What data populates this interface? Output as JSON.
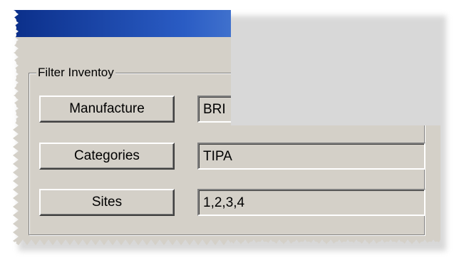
{
  "window": {
    "titlebar_colors": [
      "#0b2f8a",
      "#2a5cc4",
      "#6f9ee0",
      "#a6caf0"
    ]
  },
  "filter_group": {
    "title": "Filter Inventoy",
    "rows": [
      {
        "button_label": "Manufacture",
        "value": "BRI"
      },
      {
        "button_label": "Categories",
        "value": "TIPA"
      },
      {
        "button_label": "Sites",
        "value": "1,2,3,4"
      }
    ]
  }
}
